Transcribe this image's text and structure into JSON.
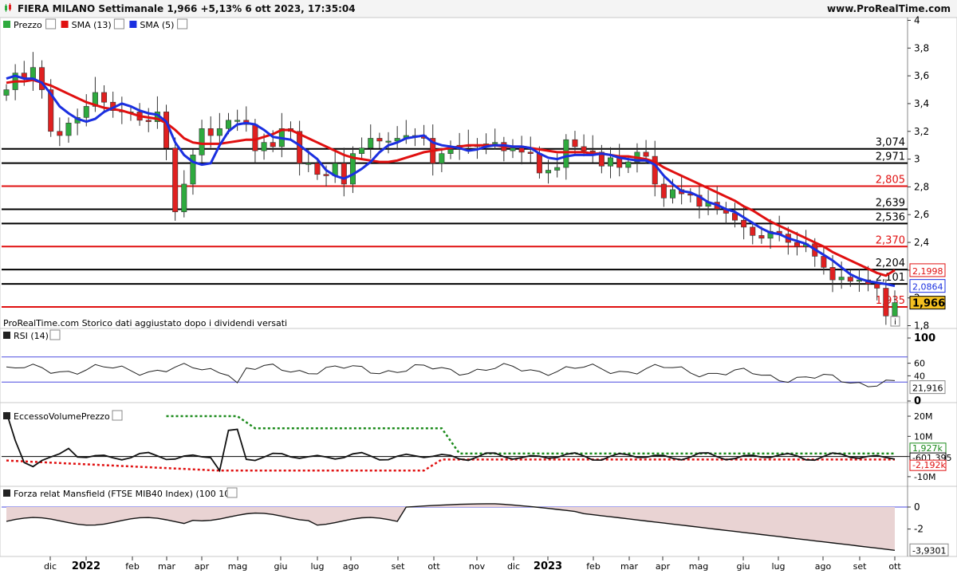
{
  "header": {
    "title": "FIERA MILANO Settimanale 1,966 +5,13% 6 ott 2023, 17:35:04",
    "site": "www.ProRealTime.com"
  },
  "colors": {
    "up": "#2eaa3e",
    "down": "#e02020",
    "sma13": "#e01010",
    "sma5": "#1a2fe0",
    "support_black": "#000000",
    "support_red": "#e01010",
    "price_badge": "#f4c020"
  },
  "price_panel": {
    "legend": [
      {
        "label": "Prezzo",
        "color": "#2eaa3e",
        "icon": "candle-icon"
      },
      {
        "label": "SMA (13)",
        "color": "#e01010",
        "icon": "wrench-icon"
      },
      {
        "label": "SMA (5)",
        "color": "#1a2fe0",
        "icon": "wrench-icon"
      }
    ],
    "footnote": "ProRealTime.com Storico dati aggiustato dopo i dividendi versati",
    "y_ticks": [
      "4",
      "3,8",
      "3,6",
      "3,4",
      "3,2",
      "3",
      "2,8",
      "2,6",
      "2,4",
      "2,2",
      "2",
      "1,8"
    ],
    "ylim": [
      1.78,
      4.02
    ],
    "levels": [
      {
        "value": 3.074,
        "label": "3,074",
        "color": "#000000"
      },
      {
        "value": 2.971,
        "label": "2,971",
        "color": "#000000"
      },
      {
        "value": 2.805,
        "label": "2,805",
        "color": "#e01010"
      },
      {
        "value": 2.639,
        "label": "2,639",
        "color": "#000000"
      },
      {
        "value": 2.536,
        "label": "2,536",
        "color": "#000000"
      },
      {
        "value": 2.37,
        "label": "2,370",
        "color": "#e01010"
      },
      {
        "value": 2.204,
        "label": "2,204",
        "color": "#000000"
      },
      {
        "value": 2.101,
        "label": "2,101",
        "color": "#000000"
      },
      {
        "value": 1.935,
        "label": "1,935",
        "color": "#e01010"
      }
    ],
    "badges": [
      {
        "label": "2,1998",
        "color": "#e01010"
      },
      {
        "label": "2,0864",
        "color": "#1a2fe0"
      },
      {
        "label": "1,966",
        "color": "#000000"
      }
    ]
  },
  "rsi_panel": {
    "legend": "RSI (14)",
    "y_ticks": [
      "100",
      "60",
      "40",
      "0"
    ],
    "levels": [
      70,
      30
    ],
    "value_label": "21,916"
  },
  "evp_panel": {
    "legend": "EccessoVolumePrezzo",
    "y_ticks": [
      "20M",
      "10M",
      "0",
      "-10M"
    ],
    "labels": [
      {
        "text": "1,927k",
        "color": "#1a8a1a"
      },
      {
        "text": "-601,395",
        "color": "#000000"
      },
      {
        "text": "-2,192k",
        "color": "#e01010"
      }
    ]
  },
  "mansfield_panel": {
    "legend": "Forza relat Mansfield (FTSE MIB40 Index) (100 10)",
    "y_ticks": [
      "0",
      "-2"
    ],
    "value_label": "-3,9301"
  },
  "x_axis": {
    "labels": [
      "dic",
      "2022",
      "feb",
      "mar",
      "apr",
      "mag",
      "giu",
      "lug",
      "ago",
      "set",
      "ott",
      "nov",
      "dic",
      "2023",
      "feb",
      "mar",
      "apr",
      "mag",
      "giu",
      "lug",
      "ago",
      "set",
      "ott"
    ]
  },
  "chart_data": {
    "type": "candlestick",
    "title": "FIERA MILANO Settimanale",
    "series": [
      {
        "name": "Prezzo",
        "closes": [
          3.5,
          3.62,
          3.58,
          3.66,
          3.5,
          3.2,
          3.17,
          3.26,
          3.3,
          3.38,
          3.48,
          3.41,
          3.35,
          3.34,
          3.34,
          3.28,
          3.27,
          3.34,
          3.08,
          2.62,
          2.82,
          3.03,
          3.22,
          3.17,
          3.22,
          3.28,
          3.28,
          3.25,
          3.06,
          3.12,
          3.09,
          3.22,
          3.2,
          2.97,
          2.97,
          2.89,
          2.88,
          2.97,
          2.82,
          3.04,
          3.08,
          3.15,
          3.13,
          3.13,
          3.15,
          3.17,
          3.17,
          3.15,
          2.97,
          3.04,
          3.07,
          3.1,
          3.09,
          3.1,
          3.11,
          3.12,
          3.06,
          3.08,
          3.05,
          3.04,
          2.9,
          2.92,
          2.94,
          3.14,
          3.09,
          3.06,
          3.05,
          2.95,
          3.01,
          2.94,
          2.98,
          3.05,
          3.02,
          2.82,
          2.72,
          2.78,
          2.75,
          2.74,
          2.66,
          2.69,
          2.64,
          2.61,
          2.56,
          2.51,
          2.45,
          2.43,
          2.48,
          2.46,
          2.4,
          2.37,
          2.39,
          2.3,
          2.22,
          2.13,
          2.15,
          2.12,
          2.13,
          2.1,
          2.07,
          1.87,
          1.966
        ]
      },
      {
        "name": "SMA (13)",
        "values": [
          3.55,
          3.56,
          3.56,
          3.57,
          3.55,
          3.53,
          3.5,
          3.47,
          3.44,
          3.41,
          3.39,
          3.37,
          3.36,
          3.35,
          3.33,
          3.31,
          3.3,
          3.29,
          3.26,
          3.21,
          3.15,
          3.12,
          3.11,
          3.11,
          3.11,
          3.12,
          3.13,
          3.14,
          3.14,
          3.16,
          3.18,
          3.21,
          3.21,
          3.18,
          3.15,
          3.12,
          3.09,
          3.06,
          3.03,
          3.01,
          3.0,
          2.99,
          2.98,
          2.98,
          2.99,
          3.01,
          3.03,
          3.05,
          3.06,
          3.07,
          3.08,
          3.09,
          3.1,
          3.1,
          3.1,
          3.1,
          3.09,
          3.09,
          3.09,
          3.08,
          3.07,
          3.06,
          3.05,
          3.05,
          3.05,
          3.05,
          3.04,
          3.04,
          3.03,
          3.02,
          3.02,
          3.01,
          3.0,
          2.98,
          2.94,
          2.91,
          2.88,
          2.85,
          2.82,
          2.79,
          2.76,
          2.73,
          2.7,
          2.66,
          2.63,
          2.59,
          2.55,
          2.52,
          2.49,
          2.46,
          2.43,
          2.4,
          2.37,
          2.33,
          2.3,
          2.27,
          2.24,
          2.21,
          2.18,
          2.16,
          2.1998
        ]
      },
      {
        "name": "SMA (5)",
        "values": [
          3.58,
          3.6,
          3.58,
          3.58,
          3.55,
          3.47,
          3.38,
          3.33,
          3.29,
          3.27,
          3.29,
          3.34,
          3.37,
          3.4,
          3.38,
          3.35,
          3.33,
          3.32,
          3.27,
          3.12,
          3.03,
          2.98,
          2.96,
          2.97,
          3.1,
          3.2,
          3.25,
          3.26,
          3.25,
          3.21,
          3.16,
          3.15,
          3.14,
          3.1,
          3.05,
          3.0,
          2.92,
          2.88,
          2.86,
          2.89,
          2.93,
          2.98,
          3.05,
          3.1,
          3.12,
          3.15,
          3.16,
          3.17,
          3.12,
          3.1,
          3.09,
          3.08,
          3.06,
          3.07,
          3.09,
          3.1,
          3.1,
          3.09,
          3.09,
          3.08,
          3.04,
          3.01,
          3.0,
          3.02,
          3.03,
          3.03,
          3.03,
          3.04,
          3.03,
          3.01,
          3.0,
          2.99,
          2.99,
          2.96,
          2.88,
          2.82,
          2.77,
          2.76,
          2.73,
          2.69,
          2.67,
          2.64,
          2.62,
          2.58,
          2.54,
          2.5,
          2.47,
          2.46,
          2.43,
          2.41,
          2.39,
          2.35,
          2.31,
          2.27,
          2.22,
          2.17,
          2.14,
          2.12,
          2.11,
          2.1,
          2.0864
        ]
      }
    ],
    "ylim": [
      1.78,
      4.02
    ]
  }
}
